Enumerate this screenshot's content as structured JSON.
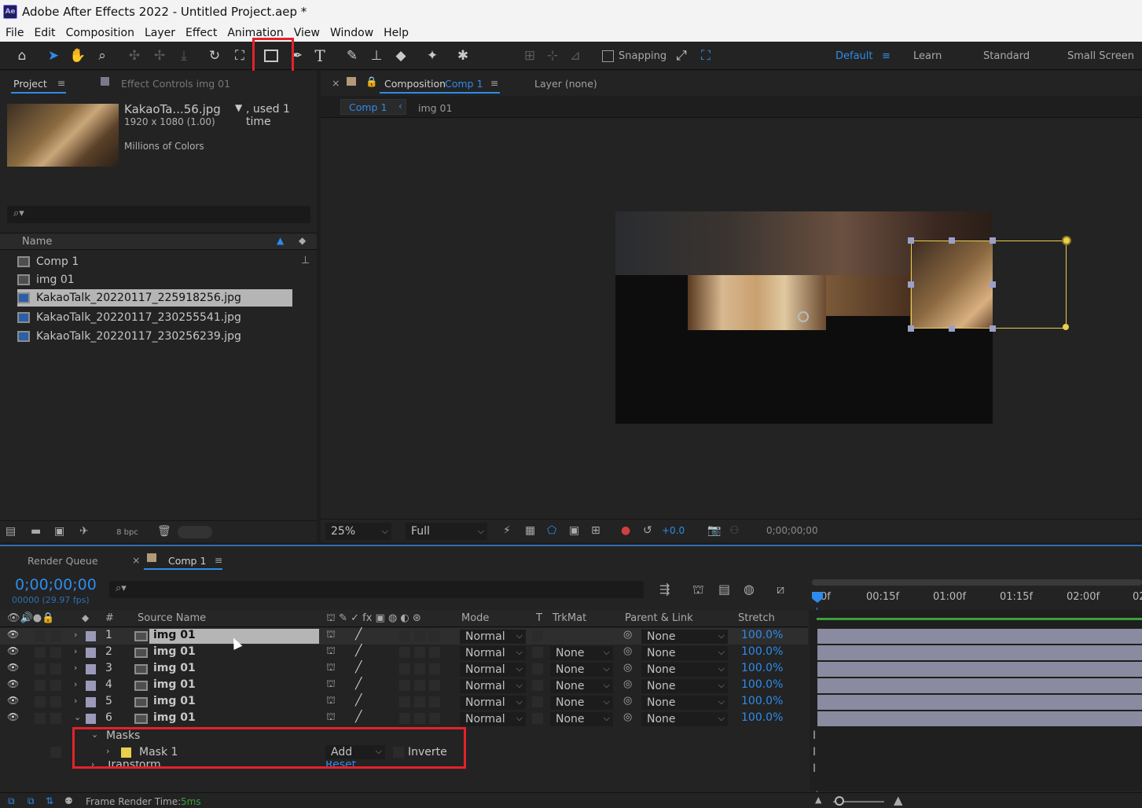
{
  "window": {
    "title": "Adobe After Effects 2022 - Untitled Project.aep *",
    "app_icon": "Ae"
  },
  "menu": [
    "File",
    "Edit",
    "Composition",
    "Layer",
    "Effect",
    "Animation",
    "View",
    "Window",
    "Help"
  ],
  "toolbar": {
    "snapping_label": "Snapping",
    "workspaces": {
      "default": "Default",
      "learn": "Learn",
      "standard": "Standard",
      "small_screen": "Small Screen"
    }
  },
  "project_panel": {
    "tab_label": "Project",
    "effect_controls_label": "Effect Controls img 01",
    "preview": {
      "filename": "KakaoTa...56.jpg",
      "used": ", used 1 time",
      "dims": "1920 x 1080 (1.00)",
      "colors": "Millions of Colors"
    },
    "column_name": "Name",
    "items": [
      {
        "label": "Comp 1",
        "type": "comp"
      },
      {
        "label": "img 01",
        "type": "comp"
      },
      {
        "label": "KakaoTalk_20220117_225918256.jpg",
        "type": "image",
        "selected": true
      },
      {
        "label": "KakaoTalk_20220117_230255541.jpg",
        "type": "image"
      },
      {
        "label": "KakaoTalk_20220117_230256239.jpg",
        "type": "image"
      }
    ],
    "bpc_label": "8 bpc"
  },
  "composition_panel": {
    "tab_prefix": "Composition",
    "comp_name": "Comp 1",
    "layer_tab": "Layer (none)",
    "breadcrumbs": [
      "Comp 1",
      "img 01"
    ],
    "zoom": "25%",
    "resolution": "Full",
    "exposure": "+0.0",
    "timecode": "0;00;00;00"
  },
  "timeline": {
    "render_queue_label": "Render Queue",
    "comp_tab": "Comp 1",
    "current_time": "0;00;00;00",
    "fps": "00000 (29.97 fps)",
    "columns": {
      "hash": "#",
      "source_name": "Source Name",
      "mode": "Mode",
      "t": "T",
      "trkmat": "TrkMat",
      "parent": "Parent & Link",
      "stretch": "Stretch"
    },
    "ruler": [
      "0f",
      "00:15f",
      "01:00f",
      "01:15f",
      "02:00f",
      "02"
    ],
    "layers": [
      {
        "num": "1",
        "name": "img 01",
        "mode": "Normal",
        "trkmat": "",
        "parent": "None",
        "stretch": "100.0%",
        "expanded": false
      },
      {
        "num": "2",
        "name": "img 01",
        "mode": "Normal",
        "trkmat": "None",
        "parent": "None",
        "stretch": "100.0%",
        "expanded": false
      },
      {
        "num": "3",
        "name": "img 01",
        "mode": "Normal",
        "trkmat": "None",
        "parent": "None",
        "stretch": "100.0%",
        "expanded": false
      },
      {
        "num": "4",
        "name": "img 01",
        "mode": "Normal",
        "trkmat": "None",
        "parent": "None",
        "stretch": "100.0%",
        "expanded": false
      },
      {
        "num": "5",
        "name": "img 01",
        "mode": "Normal",
        "trkmat": "None",
        "parent": "None",
        "stretch": "100.0%",
        "expanded": false
      },
      {
        "num": "6",
        "name": "img 01",
        "mode": "Normal",
        "trkmat": "None",
        "parent": "None",
        "stretch": "100.0%",
        "expanded": true
      }
    ],
    "masks_label": "Masks",
    "mask": {
      "name": "Mask 1",
      "mode": "Add",
      "inverted_label": "Inverte",
      "color": "#e8cf4e"
    },
    "transform_label": "Transform",
    "reset_label": "Reset",
    "footer": {
      "label": "Frame Render Time:",
      "value": "5ms"
    }
  },
  "colors": {
    "accent": "#2d8ceb",
    "highlight_red": "#e3222a",
    "mask_yellow": "#e8cf4e",
    "bar": "#8a8aa0"
  }
}
